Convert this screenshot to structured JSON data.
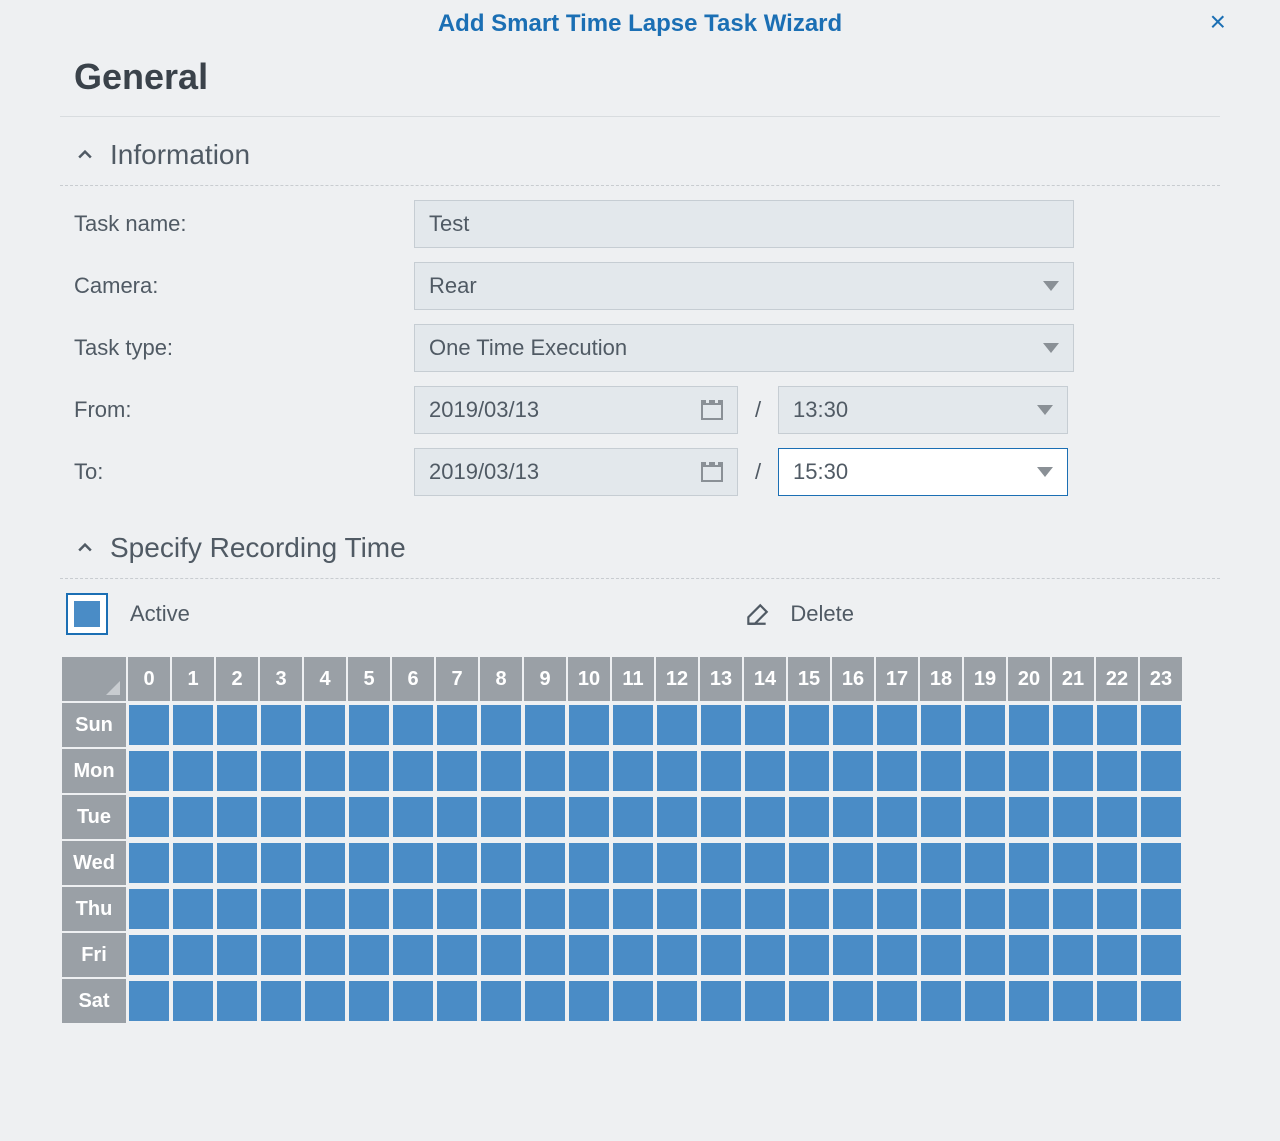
{
  "dialog": {
    "title": "Add Smart Time Lapse Task Wizard"
  },
  "page": {
    "title": "General"
  },
  "sections": {
    "information": {
      "title": "Information"
    },
    "recording": {
      "title": "Specify Recording Time"
    }
  },
  "form": {
    "task_name_label": "Task name:",
    "task_name_value": "Test",
    "camera_label": "Camera:",
    "camera_value": "Rear",
    "task_type_label": "Task type:",
    "task_type_value": "One Time Execution",
    "from_label": "From:",
    "from_date": "2019/03/13",
    "from_time": "13:30",
    "to_label": "To:",
    "to_date": "2019/03/13",
    "to_time": "15:30",
    "separator": "/"
  },
  "legend": {
    "active_label": "Active",
    "delete_label": "Delete"
  },
  "schedule": {
    "hours": [
      "0",
      "1",
      "2",
      "3",
      "4",
      "5",
      "6",
      "7",
      "8",
      "9",
      "10",
      "11",
      "12",
      "13",
      "14",
      "15",
      "16",
      "17",
      "18",
      "19",
      "20",
      "21",
      "22",
      "23"
    ],
    "days": [
      "Sun",
      "Mon",
      "Tue",
      "Wed",
      "Thu",
      "Fri",
      "Sat"
    ]
  }
}
